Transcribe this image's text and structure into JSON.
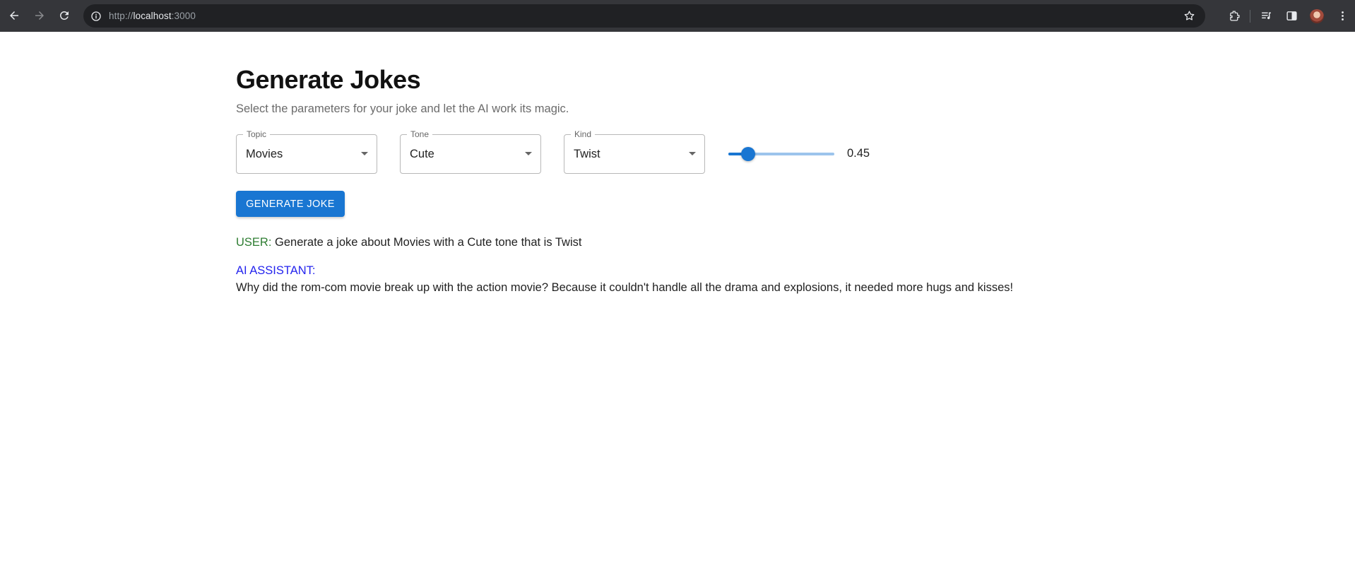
{
  "browser": {
    "url_scheme": "http://",
    "url_host": "localhost",
    "url_port": ":3000"
  },
  "page": {
    "title": "Generate Jokes",
    "subtitle": "Select the parameters for your joke and let the AI work its magic."
  },
  "controls": {
    "topic": {
      "label": "Topic",
      "value": "Movies"
    },
    "tone": {
      "label": "Tone",
      "value": "Cute"
    },
    "kind": {
      "label": "Kind",
      "value": "Twist"
    },
    "temperature": {
      "value": 0.45,
      "display": "0.45",
      "min": 0,
      "max": 1
    }
  },
  "button": {
    "label": "GENERATE JOKE"
  },
  "conversation": {
    "user_tag": "USER:",
    "user_message": "Generate a joke about Movies with a Cute tone that is Twist",
    "ai_tag": "AI ASSISTANT:",
    "ai_message": "Why did the rom-com movie break up with the action movie? Because it couldn't handle all the drama and explosions, it needed more hugs and kisses!"
  },
  "colors": {
    "accent": "#1976d2",
    "user_tag": "#2e7d32",
    "ai_tag": "#2323ee"
  }
}
